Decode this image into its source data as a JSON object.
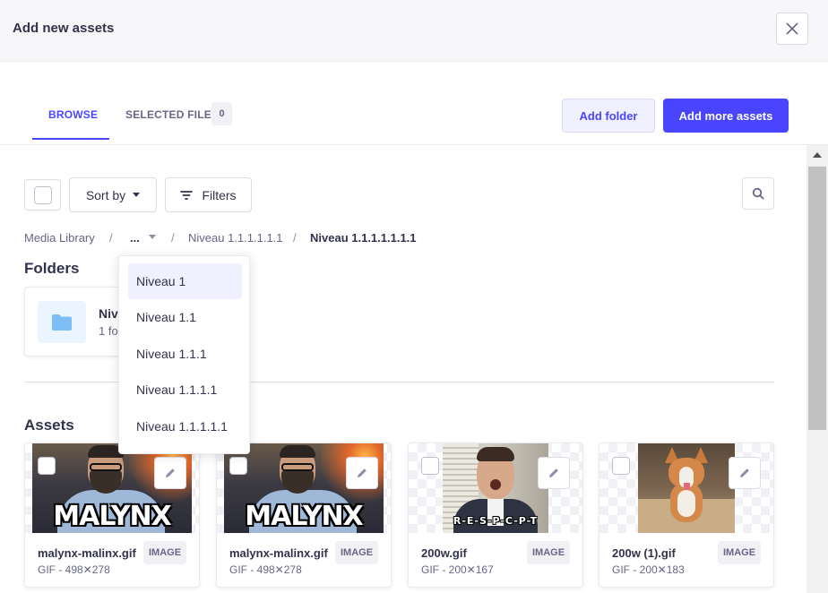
{
  "modal": {
    "title": "Add new assets"
  },
  "tabs": [
    {
      "label": "Browse",
      "active": true
    },
    {
      "label": "Selected files",
      "active": false
    }
  ],
  "selected_count": "0",
  "actions": {
    "add_folder": "Add folder",
    "add_more_assets": "Add more assets"
  },
  "toolbar": {
    "sort_label": "Sort by",
    "filters_label": "Filters"
  },
  "breadcrumb": {
    "root": "Media Library",
    "ellipsis": "...",
    "separator": "/",
    "parent": "Niveau 1.1.1.1.1.1",
    "current": "Niveau 1.1.1.1.1.1.1"
  },
  "breadcrumb_menu": {
    "items": [
      "Niveau 1",
      "Niveau 1.1",
      "Niveau 1.1.1",
      "Niveau 1.1.1.1",
      "Niveau 1.1.1.1.1"
    ]
  },
  "folders": {
    "title": "Folders",
    "items": [
      {
        "name": "Niv",
        "meta": "1 fo"
      }
    ]
  },
  "assets": {
    "title": "Assets",
    "items": [
      {
        "name": "malynx-malinx.gif",
        "meta": "GIF - 498✕278",
        "type": "Image",
        "overlay_text": "MALYNX"
      },
      {
        "name": "malynx-malinx.gif",
        "meta": "GIF - 498✕278",
        "type": "Image",
        "overlay_text": "MALYNX"
      },
      {
        "name": "200w.gif",
        "meta": "GIF - 200✕167",
        "type": "Image",
        "overlay_text": "R-E-S-P-C-P-T"
      },
      {
        "name": "200w (1).gif",
        "meta": "GIF - 200✕183",
        "type": "Image"
      }
    ]
  },
  "colors": {
    "primary": "#4945ff",
    "primary_light": "#f0f0ff",
    "text": "#32324d",
    "muted": "#666687",
    "border": "#dcdce4"
  }
}
